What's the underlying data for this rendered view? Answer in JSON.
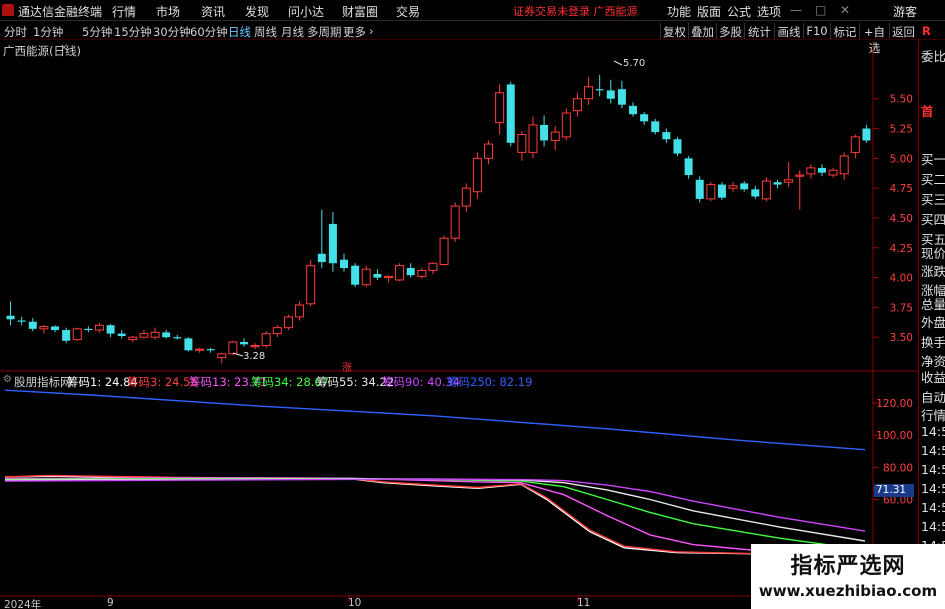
{
  "menubar": {
    "app_name": "通达信金融终端",
    "items": [
      "行情",
      "市场",
      "资讯",
      "发现",
      "问小达",
      "财富圈",
      "交易"
    ],
    "warning": "证券交易未登录  广西能源",
    "right_items": [
      "功能",
      "版面",
      "公式",
      "选项"
    ],
    "guest": "游客"
  },
  "tabbar": {
    "periods": [
      "分时",
      "1分钟",
      "5分钟",
      "15分钟",
      "30分钟",
      "60分钟",
      "日线",
      "周线",
      "月线",
      "多周期",
      "更多"
    ],
    "active": "日线",
    "more_arrow": "›",
    "buttons": [
      "复权",
      "叠加",
      "多股",
      "统计",
      "画线",
      "F10",
      "标记",
      "+自选",
      "返回"
    ]
  },
  "main_chart": {
    "title": "广西能源(日线)",
    "high_label": "5.70",
    "low_label": "3.28",
    "limit_mark": "涨",
    "price_ticks": [
      "5.50",
      "5.25",
      "5.00",
      "4.75",
      "4.50",
      "4.25",
      "4.00",
      "3.75",
      "3.50"
    ],
    "colors": {
      "up": "#ff3c3c",
      "down": "#44e0e8",
      "bg": "#000000",
      "grid": "#6a0000"
    }
  },
  "indicator": {
    "name": "股朋指标网",
    "legend": [
      {
        "label": "筹码1: 24.84",
        "color": "#ffffff"
      },
      {
        "label": "筹码3: 24.55",
        "color": "#ff4040"
      },
      {
        "label": "筹码13: 23.71",
        "color": "#ff55ff"
      },
      {
        "label": "筹码34: 28.67",
        "color": "#40ff40"
      },
      {
        "label": "筹码55: 34.22",
        "color": "#e8e8e8"
      },
      {
        "label": "筹码90: 40.34",
        "color": "#cc44ff"
      },
      {
        "label": "筹码250: 82.19",
        "color": "#3060ff"
      }
    ],
    "ticks": [
      "120.00",
      "100.00",
      "80.00",
      "60.00"
    ],
    "current_value": "71.31"
  },
  "date_axis": [
    "2024年",
    "9",
    "10",
    "11"
  ],
  "right_panel": {
    "indicator_r": "R",
    "labels": [
      "委比",
      "首",
      "买一",
      "买二",
      "买三",
      "买四",
      "买五",
      "现价",
      "涨跌",
      "涨幅",
      "总量",
      "外盘",
      "换手",
      "净资",
      "收益",
      "自动",
      "行情",
      "14:5",
      "14:5",
      "14:5",
      "14:5",
      "14:5",
      "14:5",
      "14:5",
      "14:5"
    ]
  },
  "watermark": {
    "title": "指标严选网",
    "url": "www.xuezhibiao.com"
  },
  "chart_data": {
    "type": "candlestick",
    "title": "广西能源(日线)",
    "ylim": [
      3.25,
      5.85
    ],
    "yticks": [
      3.5,
      3.75,
      4.0,
      4.25,
      4.5,
      4.75,
      5.0,
      5.25,
      5.5
    ],
    "x_labels": [
      "2024年",
      "9",
      "10",
      "11"
    ],
    "candles": [
      [
        3.68,
        3.8,
        3.6,
        3.65
      ],
      [
        3.64,
        3.67,
        3.6,
        3.63
      ],
      [
        3.63,
        3.66,
        3.55,
        3.57
      ],
      [
        3.57,
        3.6,
        3.53,
        3.59
      ],
      [
        3.59,
        3.6,
        3.54,
        3.56
      ],
      [
        3.56,
        3.58,
        3.45,
        3.47
      ],
      [
        3.48,
        3.58,
        3.47,
        3.57
      ],
      [
        3.57,
        3.59,
        3.54,
        3.56
      ],
      [
        3.56,
        3.62,
        3.54,
        3.6
      ],
      [
        3.6,
        3.61,
        3.5,
        3.53
      ],
      [
        3.53,
        3.56,
        3.49,
        3.51
      ],
      [
        3.48,
        3.51,
        3.46,
        3.5
      ],
      [
        3.5,
        3.56,
        3.49,
        3.53
      ],
      [
        3.5,
        3.58,
        3.48,
        3.54
      ],
      [
        3.54,
        3.56,
        3.49,
        3.5
      ],
      [
        3.5,
        3.52,
        3.48,
        3.49
      ],
      [
        3.49,
        3.5,
        3.38,
        3.39
      ],
      [
        3.39,
        3.41,
        3.37,
        3.4
      ],
      [
        3.4,
        3.41,
        3.37,
        3.39
      ],
      [
        3.33,
        3.37,
        3.28,
        3.36
      ],
      [
        3.36,
        3.47,
        3.35,
        3.46
      ],
      [
        3.46,
        3.49,
        3.42,
        3.44
      ],
      [
        3.42,
        3.45,
        3.4,
        3.43
      ],
      [
        3.43,
        3.55,
        3.41,
        3.53
      ],
      [
        3.53,
        3.6,
        3.5,
        3.58
      ],
      [
        3.58,
        3.69,
        3.56,
        3.67
      ],
      [
        3.67,
        3.8,
        3.64,
        3.77
      ],
      [
        3.78,
        4.15,
        3.76,
        4.1
      ],
      [
        4.2,
        4.57,
        4.08,
        4.13
      ],
      [
        4.45,
        4.55,
        4.05,
        4.12
      ],
      [
        4.15,
        4.2,
        4.05,
        4.08
      ],
      [
        4.1,
        4.12,
        3.92,
        3.94
      ],
      [
        3.94,
        4.1,
        3.92,
        4.07
      ],
      [
        4.03,
        4.07,
        3.98,
        4.0
      ],
      [
        4.0,
        4.02,
        3.96,
        4.01
      ],
      [
        3.98,
        4.12,
        3.97,
        4.1
      ],
      [
        4.08,
        4.12,
        4.0,
        4.02
      ],
      [
        4.01,
        4.08,
        3.99,
        4.06
      ],
      [
        4.06,
        4.13,
        4.03,
        4.12
      ],
      [
        4.11,
        4.35,
        4.1,
        4.33
      ],
      [
        4.33,
        4.63,
        4.3,
        4.6
      ],
      [
        4.6,
        4.79,
        4.55,
        4.75
      ],
      [
        4.72,
        5.05,
        4.66,
        5.0
      ],
      [
        5.0,
        5.15,
        4.95,
        5.12
      ],
      [
        5.3,
        5.62,
        5.2,
        5.55
      ],
      [
        5.62,
        5.64,
        5.1,
        5.13
      ],
      [
        5.05,
        5.23,
        4.98,
        5.2
      ],
      [
        5.05,
        5.35,
        5.0,
        5.28
      ],
      [
        5.28,
        5.36,
        5.1,
        5.15
      ],
      [
        5.15,
        5.27,
        5.07,
        5.22
      ],
      [
        5.18,
        5.42,
        5.15,
        5.38
      ],
      [
        5.4,
        5.55,
        5.35,
        5.5
      ],
      [
        5.5,
        5.68,
        5.45,
        5.6
      ],
      [
        5.58,
        5.7,
        5.52,
        5.57
      ],
      [
        5.57,
        5.66,
        5.46,
        5.5
      ],
      [
        5.58,
        5.65,
        5.42,
        5.45
      ],
      [
        5.44,
        5.47,
        5.35,
        5.37
      ],
      [
        5.37,
        5.39,
        5.28,
        5.31
      ],
      [
        5.31,
        5.33,
        5.2,
        5.22
      ],
      [
        5.22,
        5.25,
        5.13,
        5.16
      ],
      [
        5.16,
        5.18,
        5.02,
        5.04
      ],
      [
        5.0,
        5.02,
        4.83,
        4.86
      ],
      [
        4.82,
        4.85,
        4.63,
        4.66
      ],
      [
        4.66,
        4.8,
        4.64,
        4.78
      ],
      [
        4.78,
        4.8,
        4.65,
        4.67
      ],
      [
        4.75,
        4.8,
        4.72,
        4.77
      ],
      [
        4.79,
        4.81,
        4.72,
        4.74
      ],
      [
        4.74,
        4.77,
        4.66,
        4.68
      ],
      [
        4.66,
        4.84,
        4.64,
        4.81
      ],
      [
        4.8,
        4.82,
        4.75,
        4.78
      ],
      [
        4.8,
        4.97,
        4.76,
        4.82
      ],
      [
        4.85,
        4.9,
        4.57,
        4.86
      ],
      [
        4.87,
        4.95,
        4.83,
        4.92
      ],
      [
        4.92,
        4.95,
        4.85,
        4.88
      ],
      [
        4.86,
        4.92,
        4.84,
        4.9
      ],
      [
        4.87,
        5.05,
        4.82,
        5.02
      ],
      [
        5.05,
        5.2,
        5.0,
        5.18
      ],
      [
        5.25,
        5.28,
        5.13,
        5.15
      ]
    ],
    "indicator": {
      "ylim": [
        0,
        130
      ],
      "yticks": [
        60,
        80,
        100,
        120
      ],
      "series": [
        {
          "name": "筹码1",
          "color": "#ffffff",
          "points": [
            [
              0,
              74
            ],
            [
              0.05,
              74.5
            ],
            [
              0.2,
              73.5
            ],
            [
              0.4,
              73
            ],
            [
              0.44,
              70.5
            ],
            [
              0.5,
              68.5
            ],
            [
              0.55,
              67
            ],
            [
              0.6,
              69.5
            ],
            [
              0.63,
              60
            ],
            [
              0.68,
              40
            ],
            [
              0.72,
              30
            ],
            [
              0.78,
              27
            ],
            [
              0.9,
              26
            ],
            [
              1.0,
              24.84
            ]
          ]
        },
        {
          "name": "筹码3",
          "color": "#ff4040",
          "points": [
            [
              0,
              74
            ],
            [
              0.05,
              75
            ],
            [
              0.2,
              73.8
            ],
            [
              0.4,
              73.2
            ],
            [
              0.44,
              71
            ],
            [
              0.5,
              69
            ],
            [
              0.55,
              67.5
            ],
            [
              0.6,
              69.8
            ],
            [
              0.63,
              61
            ],
            [
              0.68,
              41
            ],
            [
              0.72,
              31
            ],
            [
              0.78,
              27.5
            ],
            [
              0.9,
              26
            ],
            [
              1.0,
              24.55
            ]
          ]
        },
        {
          "name": "筹码13",
          "color": "#ff55ff",
          "points": [
            [
              0,
              73
            ],
            [
              0.2,
              73.5
            ],
            [
              0.4,
              73.3
            ],
            [
              0.45,
              72.5
            ],
            [
              0.55,
              71
            ],
            [
              0.6,
              70.5
            ],
            [
              0.65,
              63
            ],
            [
              0.7,
              50
            ],
            [
              0.75,
              38
            ],
            [
              0.8,
              32
            ],
            [
              0.9,
              27
            ],
            [
              1.0,
              23.71
            ]
          ]
        },
        {
          "name": "筹码34",
          "color": "#40ff40",
          "points": [
            [
              0,
              72.5
            ],
            [
              0.2,
              73
            ],
            [
              0.4,
              73
            ],
            [
              0.5,
              72.5
            ],
            [
              0.6,
              71.5
            ],
            [
              0.65,
              68
            ],
            [
              0.7,
              60
            ],
            [
              0.75,
              52
            ],
            [
              0.8,
              45
            ],
            [
              0.9,
              36
            ],
            [
              1.0,
              28.67
            ]
          ]
        },
        {
          "name": "筹码55",
          "color": "#e8e8e8",
          "points": [
            [
              0,
              72
            ],
            [
              0.2,
              72.5
            ],
            [
              0.4,
              72.8
            ],
            [
              0.5,
              72.7
            ],
            [
              0.6,
              72.2
            ],
            [
              0.65,
              70.5
            ],
            [
              0.7,
              66
            ],
            [
              0.75,
              60
            ],
            [
              0.8,
              53
            ],
            [
              0.9,
              43
            ],
            [
              1.0,
              34.22
            ]
          ]
        },
        {
          "name": "筹码90",
          "color": "#cc44ff",
          "points": [
            [
              0,
              71.5
            ],
            [
              0.2,
              72
            ],
            [
              0.4,
              72.5
            ],
            [
              0.5,
              72.6
            ],
            [
              0.6,
              72.4
            ],
            [
              0.65,
              71.8
            ],
            [
              0.7,
              69
            ],
            [
              0.75,
              65
            ],
            [
              0.8,
              59
            ],
            [
              0.9,
              49
            ],
            [
              1.0,
              40.34
            ]
          ]
        },
        {
          "name": "筹码250",
          "color": "#3060ff",
          "points": [
            [
              0,
              128
            ],
            [
              0.1,
              125
            ],
            [
              0.3,
              118
            ],
            [
              0.5,
              112
            ],
            [
              0.7,
              104
            ],
            [
              0.85,
              97
            ],
            [
              1.0,
              91
            ]
          ]
        }
      ]
    }
  }
}
